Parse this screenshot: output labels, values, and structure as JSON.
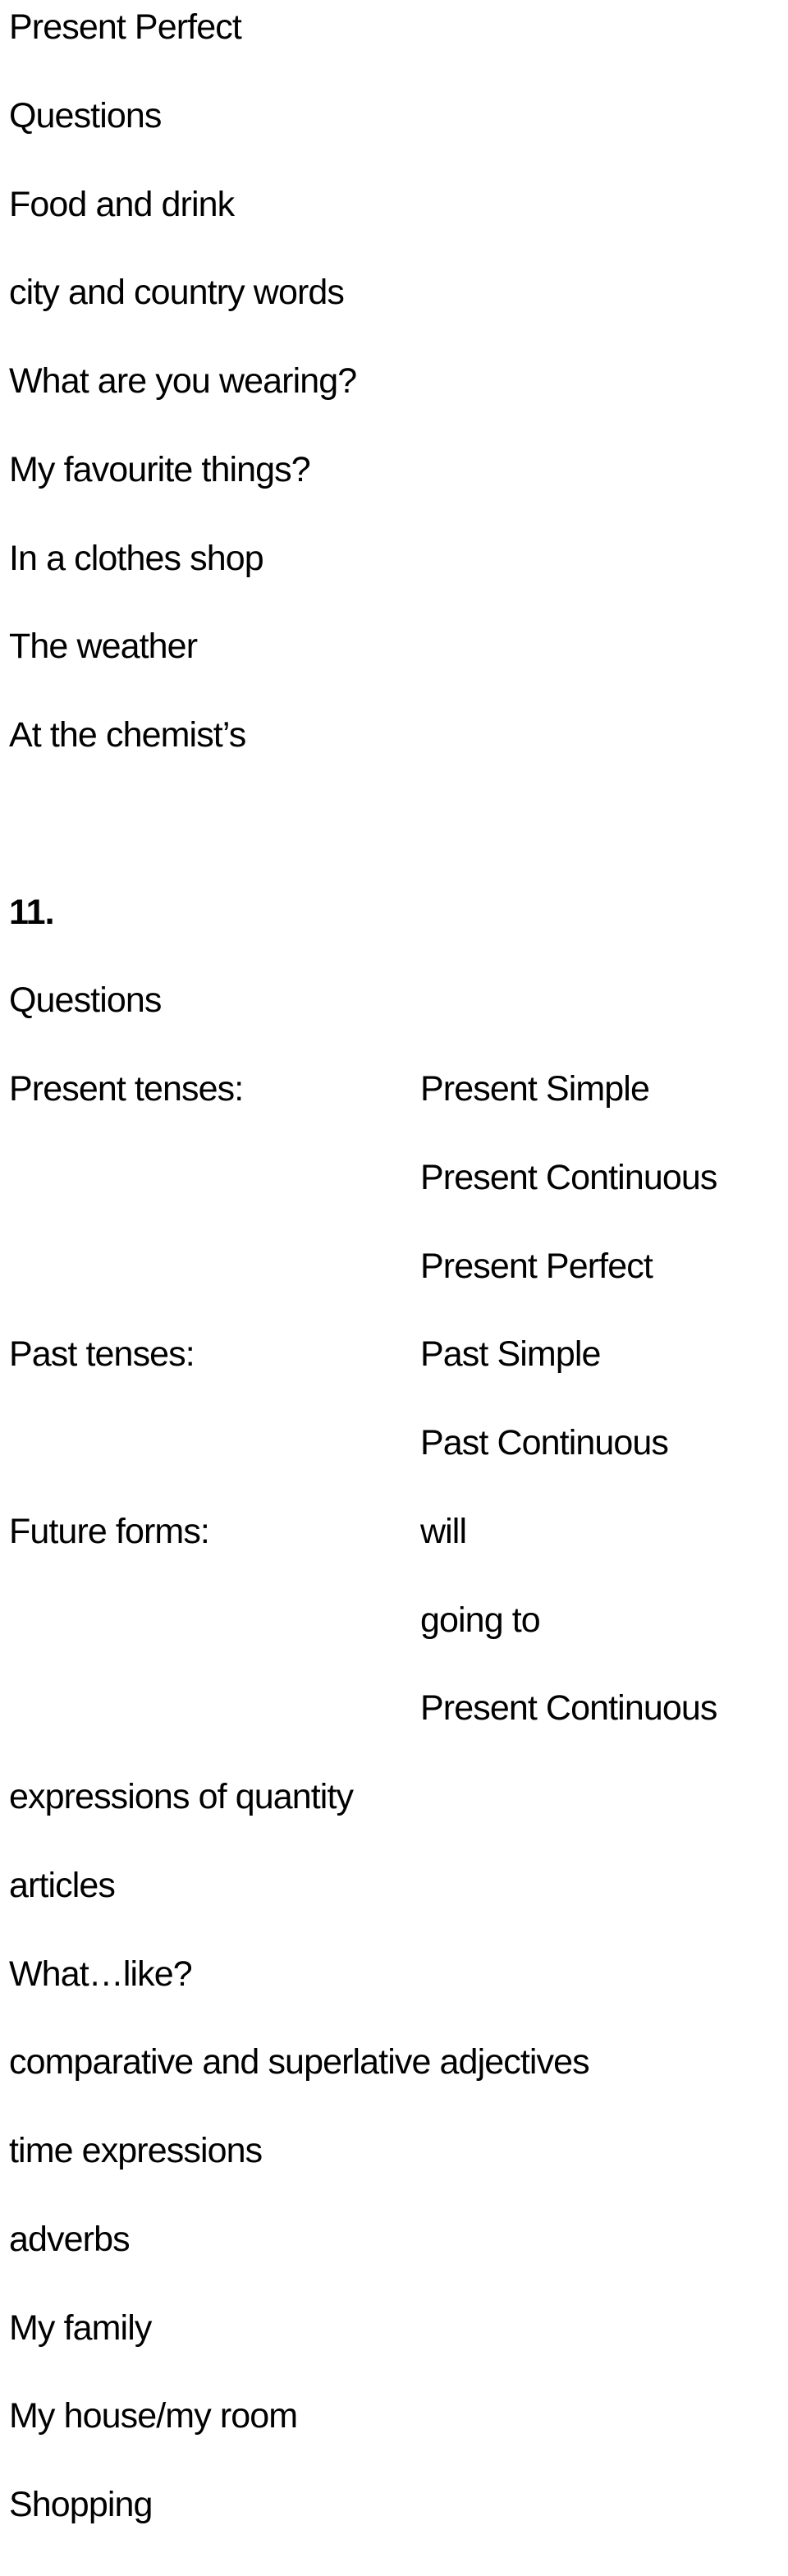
{
  "topic_list": [
    "Present Perfect",
    "Questions",
    "Food and drink",
    "city and country words",
    "What are you wearing?",
    "My favourite things?",
    "In a clothes shop",
    "The weather",
    "At the chemist’s"
  ],
  "section": {
    "number": "11.",
    "intro": "Questions",
    "grammar_groups": [
      {
        "label": "Present tenses:",
        "items": [
          "Present Simple",
          "Present Continuous",
          "Present Perfect"
        ]
      },
      {
        "label": "Past tenses:",
        "items": [
          "Past Simple",
          "Past Continuous"
        ]
      },
      {
        "label": "Future forms:",
        "items": [
          "will",
          "going to",
          "Present Continuous"
        ]
      }
    ],
    "other_topics": [
      "expressions of quantity",
      "articles",
      "What…like?",
      "comparative and superlative adjectives",
      "time expressions",
      "adverbs",
      "My family",
      "My house/my room",
      "Shopping"
    ]
  }
}
